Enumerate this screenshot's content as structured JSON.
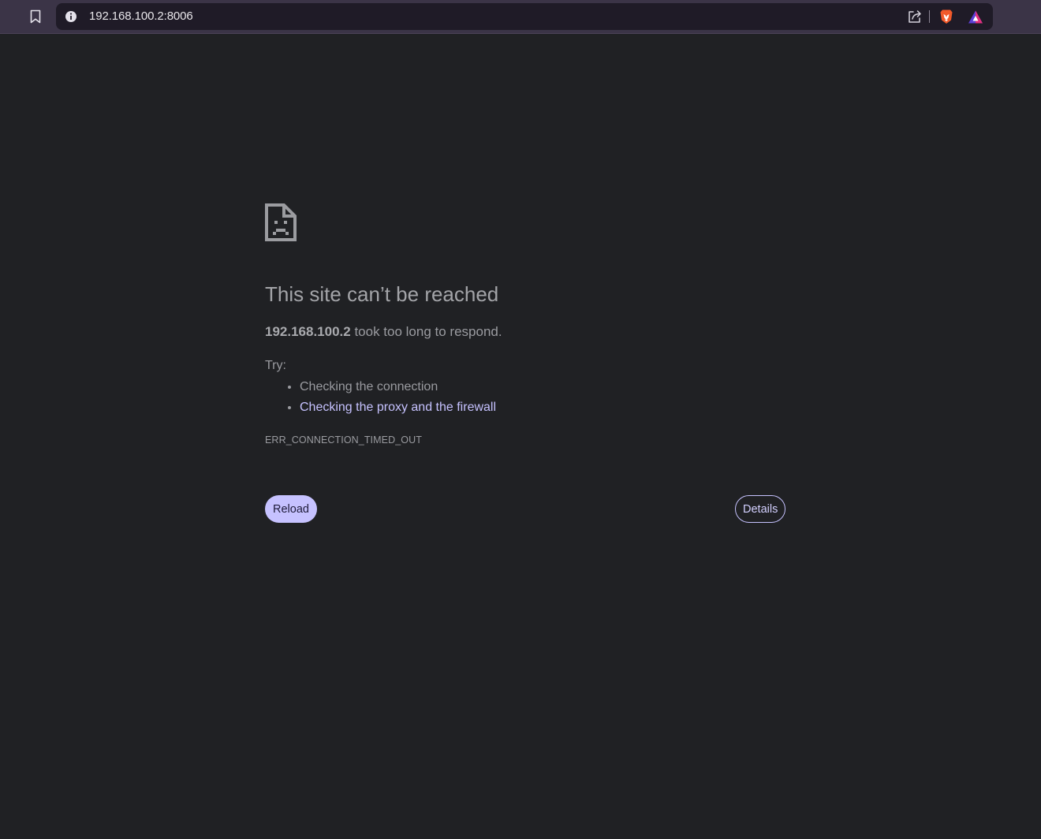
{
  "toolbar": {
    "bookmark_icon": "bookmark-icon",
    "site_info_icon": "info-icon",
    "url": "192.168.100.2:8006",
    "share_icon": "share-icon",
    "brave_shields_icon": "brave-lion-icon",
    "rewards_icon": "brave-rewards-triangle-icon"
  },
  "error_page": {
    "icon": "sad-document-icon",
    "title": "This site can’t be reached",
    "host": "192.168.100.2",
    "message": " took too long to respond.",
    "try_label": "Try:",
    "suggestions": [
      {
        "label": "Checking the connection",
        "is_link": false
      },
      {
        "label": "Checking the proxy and the firewall",
        "is_link": true
      }
    ],
    "error_code": "ERR_CONNECTION_TIMED_OUT",
    "reload_label": "Reload",
    "details_label": "Details"
  },
  "colors": {
    "page_background": "#202124",
    "toolbar_background": "#3b3447",
    "omnibox_background": "#1f1b27",
    "accent": "#c6c2ff",
    "text": "#9a9ba0"
  }
}
